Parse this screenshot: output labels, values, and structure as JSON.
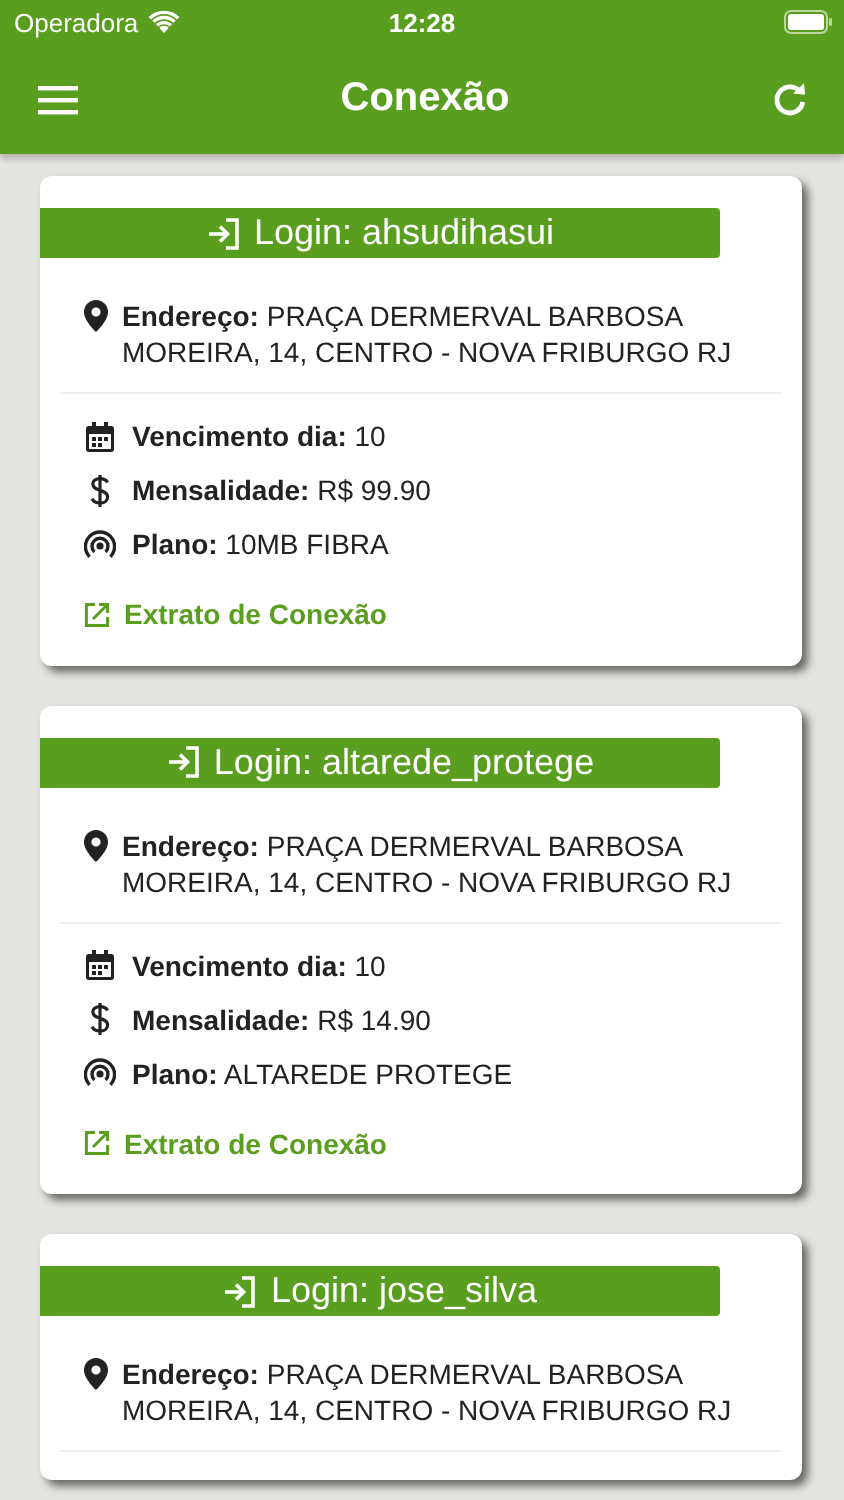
{
  "status_bar": {
    "carrier": "Operadora",
    "time": "12:28"
  },
  "app_bar": {
    "title": "Conexão"
  },
  "cards": [
    {
      "login": "Login: ahsudihasui",
      "address": "**Endereço:** PRAÇA DERMERVAL BARBOSA MOREIRA, 14, CENTRO - NOVA FRIBURGO RJ",
      "fields": [
        {
          "kind": "calendar",
          "text": "**Vencimento dia:** 10"
        },
        {
          "kind": "money",
          "text": "**Mensalidade:** R$ 99.90"
        },
        {
          "kind": "signal",
          "text": "**Plano:** 10MB FIBRA"
        }
      ],
      "link": "Extrato de Conexão"
    },
    {
      "login": "Login: altarede_protege",
      "address": "**Endereço:** PRAÇA DERMERVAL BARBOSA MOREIRA, 14, CENTRO - NOVA FRIBURGO RJ",
      "fields": [
        {
          "kind": "calendar",
          "text": "**Vencimento dia:** 10"
        },
        {
          "kind": "money",
          "text": "**Mensalidade:** R$ 14.90"
        },
        {
          "kind": "signal",
          "text": "**Plano:** ALTAREDE PROTEGE"
        }
      ],
      "link": "Extrato de Conexão"
    },
    {
      "login": "Login: jose_silva",
      "address": "**Endereço:** PRAÇA DERMERVAL BARBOSA MOREIRA, 14, CENTRO - NOVA FRIBURGO RJ"
    }
  ]
}
